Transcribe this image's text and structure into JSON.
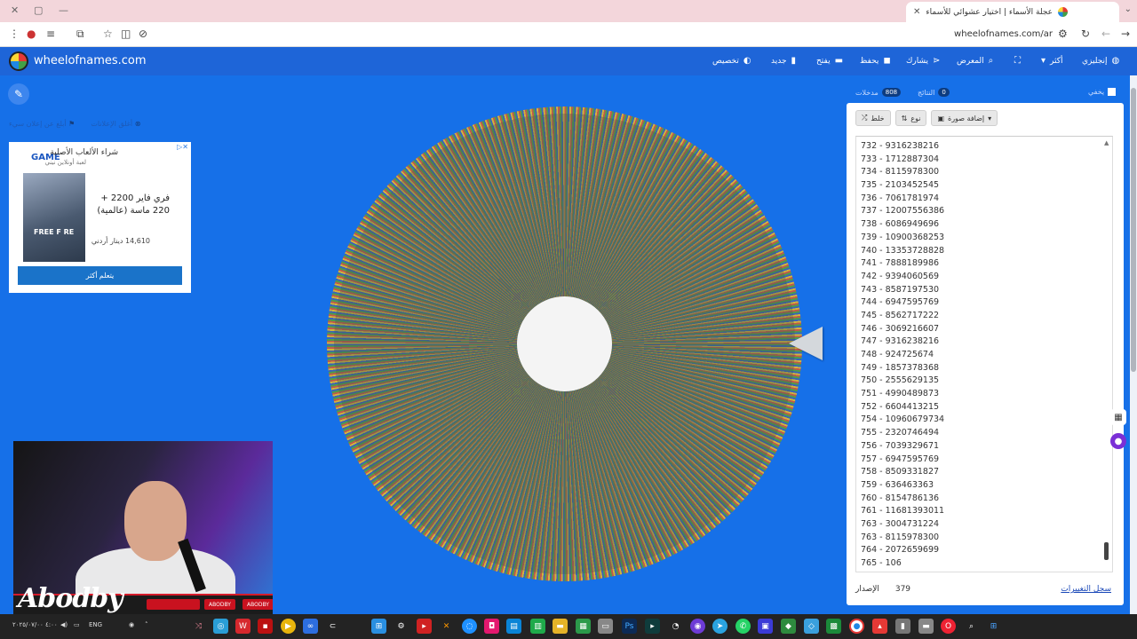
{
  "browser": {
    "tab_title": "عجلة الأسماء | اختيار عشوائي للأسماء",
    "url": "wheelofnames.com/ar"
  },
  "site": {
    "brand": "wheelofnames.com",
    "nav": {
      "customize": "تخصيص",
      "new": "جديد",
      "open": "يفتح",
      "save": "يحفظ",
      "share": "يشارك",
      "gallery": "المعرض",
      "more": "أكثر",
      "language": "إنجليزي"
    }
  },
  "ads": {
    "hide_ads": "أغلق الإعلانات",
    "report_ad": "أبلغ عن إعلان سيء",
    "brand": "GAME",
    "title": "شراء الألعاب الأصلية",
    "subtitle": "لعبة أونلاين نيني",
    "image_text": "FREE F RE",
    "offer": "فري فاير 2200 + 220 ماسة (عالمية)",
    "price": "14,610 دينار أردني",
    "button": "يتعلم أكثر"
  },
  "panel": {
    "entries_tab": "مدخلات",
    "entries_count": "808",
    "results_tab": "النتائج",
    "results_count": "0",
    "hide_label": "يخفي",
    "shuffle": "خلط",
    "sort": "نوع",
    "add_image": "إضافة صورة",
    "changelog": "سجل التغييرات",
    "version_label": "الإصدار",
    "version": "379",
    "entries": [
      "732 - 9316238216",
      "733 - 1712887304",
      "734 - 8115978300",
      "735 - 2103452545",
      "736 - 7061781974",
      "737 - 12007556386",
      "738 - 6086949696",
      "739 - 10900368253",
      "740 - 13353728828",
      "741 - 7888189986",
      "742 - 9394060569",
      "743 - 8587197530",
      "744 - 6947595769",
      "745 - 8562717222",
      "746 - 3069216607",
      "747 - 9316238216",
      "748 - 924725674",
      "749 - 1857378368",
      "750 - 2555629135",
      "751 - 4990489873",
      "752 - 6604413215",
      "754 - 10960679734",
      "755 - 2320746494",
      "756 - 7039329671",
      "757 - 6947595769",
      "758 - 8509331827",
      "759 - 636463363",
      "760 - 8154786136",
      "761 - 11681393011",
      "763 - 3004731224",
      "763 - 8115978300",
      "764 - 2072659699",
      "765 - 106"
    ]
  },
  "webcam": {
    "signature": "Abodby",
    "tag1": "ABODBY",
    "tag2": "ABODBY"
  },
  "taskbar": {
    "lang": "ENG",
    "date": "٢٠٢٥/٠٧/٠٠",
    "time": "٤:٠٠"
  }
}
